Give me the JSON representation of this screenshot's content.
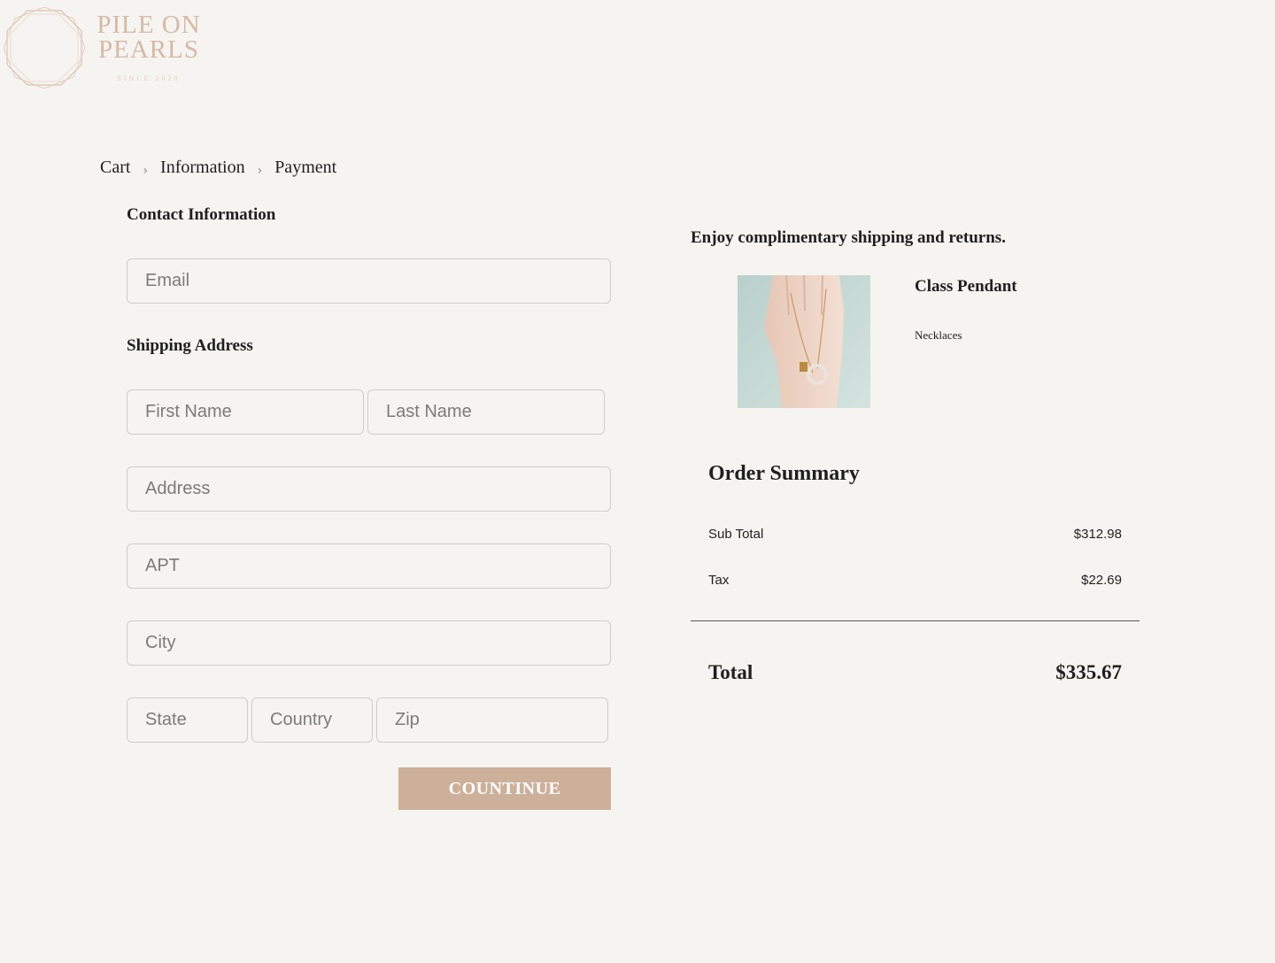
{
  "brand": {
    "name_line1": "PILE ON",
    "name_line2": "PEARLS",
    "tagline": "SINCE 2020"
  },
  "breadcrumb": {
    "items": [
      "Cart",
      "Information",
      "Payment"
    ]
  },
  "contact": {
    "title": "Contact Information",
    "email_placeholder": "Email"
  },
  "shipping": {
    "title": "Shipping Address",
    "first_name_placeholder": "First Name",
    "last_name_placeholder": "Last Name",
    "address_placeholder": "Address",
    "apt_placeholder": "APT",
    "city_placeholder": "City",
    "state_placeholder": "State",
    "country_placeholder": "Country",
    "zip_placeholder": "Zip"
  },
  "continue_label": "COUNTINUE",
  "promo": "Enjoy complimentary shipping and returns.",
  "product": {
    "name": "Class Pendant",
    "category": "Necklaces"
  },
  "summary": {
    "title": "Order Summary",
    "subtotal_label": "Sub Total",
    "subtotal_value": "$312.98",
    "tax_label": "Tax",
    "tax_value": "$22.69",
    "total_label": "Total",
    "total_value": "$335.67"
  },
  "colors": {
    "background": "#f5f4f0",
    "accent": "#cdb099",
    "logo": "#d6b9a5"
  }
}
